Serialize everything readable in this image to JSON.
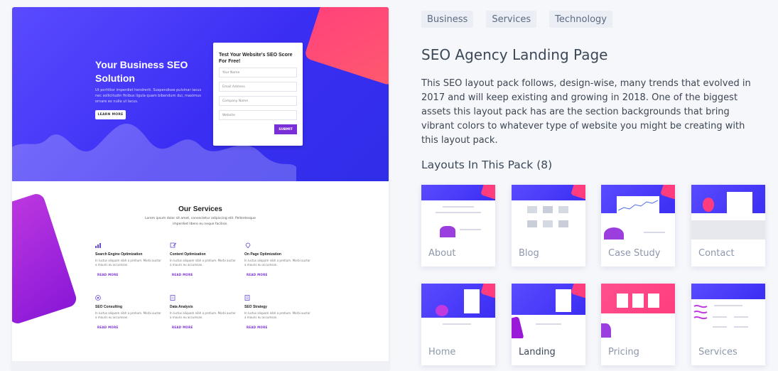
{
  "preview": {
    "hero": {
      "title": "Your Business SEO Solution",
      "text": "Ut porttitor imperdiet hendrerit. Suspendisse pulvinar lacus nec sollicitudin finibus ligula quam bibendum dui, maximus ornare ex nulla ut lacus.",
      "button": "LEARN MORE"
    },
    "form": {
      "title": "Test Your Website's SEO Score For Free!",
      "fields": [
        "Your Name",
        "Email Address",
        "Company Name",
        "Website"
      ],
      "submit": "SUBMIT"
    },
    "services": {
      "title": "Our Services",
      "subtitle": "Lorem ipsum dolor sit amet, consectetur adipiscing elit. Pellentesque imperdiet libero eu neque facilisis.",
      "items": [
        {
          "name": "Search Engine Optimization",
          "icon": "bar-chart-icon",
          "desc": "In luctus aliquam nibh a pretium. Morbi auctor a mauris eu accumsan.",
          "more": "READ MORE"
        },
        {
          "name": "Content Optimization",
          "icon": "edit-icon",
          "desc": "In luctus aliquam nibh a pretium. Morbi auctor a mauris eu accumsan.",
          "more": "READ MORE"
        },
        {
          "name": "On Page Optimization",
          "icon": "location-pin-icon",
          "desc": "In luctus aliquam nibh a pretium. Morbi auctor a mauris eu accumsan.",
          "more": "READ MORE"
        },
        {
          "name": "SEO Consulting",
          "icon": "target-icon",
          "desc": "In luctus aliquam nibh a pretium. Morbi auctor a mauris eu accumsan.",
          "more": "READ MORE"
        },
        {
          "name": "Data Analysis",
          "icon": "document-icon",
          "desc": "In luctus aliquam nibh a pretium. Morbi auctor a mauris eu accumsan.",
          "more": "READ MORE"
        },
        {
          "name": "SEO Strategy",
          "icon": "list-icon",
          "desc": "In luctus aliquam nibh a pretium. Morbi auctor a mauris eu accumsan.",
          "more": "READ MORE"
        }
      ]
    }
  },
  "tags": [
    "Business",
    "Services",
    "Technology"
  ],
  "title": "SEO Agency Landing Page",
  "description": "This SEO layout pack follows, design-wise, many trends that evolved in 2017 and will keep existing and growing in 2018. One of the biggest assets this layout pack has are the section backgrounds that bring vibrant colors to whatever type of website you might be creating with this layout pack.",
  "layouts": {
    "heading": "Layouts In This Pack (8)",
    "items": [
      "About",
      "Blog",
      "Case Study",
      "Contact",
      "Home",
      "Landing",
      "Pricing",
      "Services"
    ],
    "selected": "Landing"
  },
  "colors": {
    "hero_blue": "#3b2ef3",
    "accent_pink": "#ff3d7e",
    "accent_purple": "#7a2ed8",
    "tag_bg": "#ebeef5"
  }
}
